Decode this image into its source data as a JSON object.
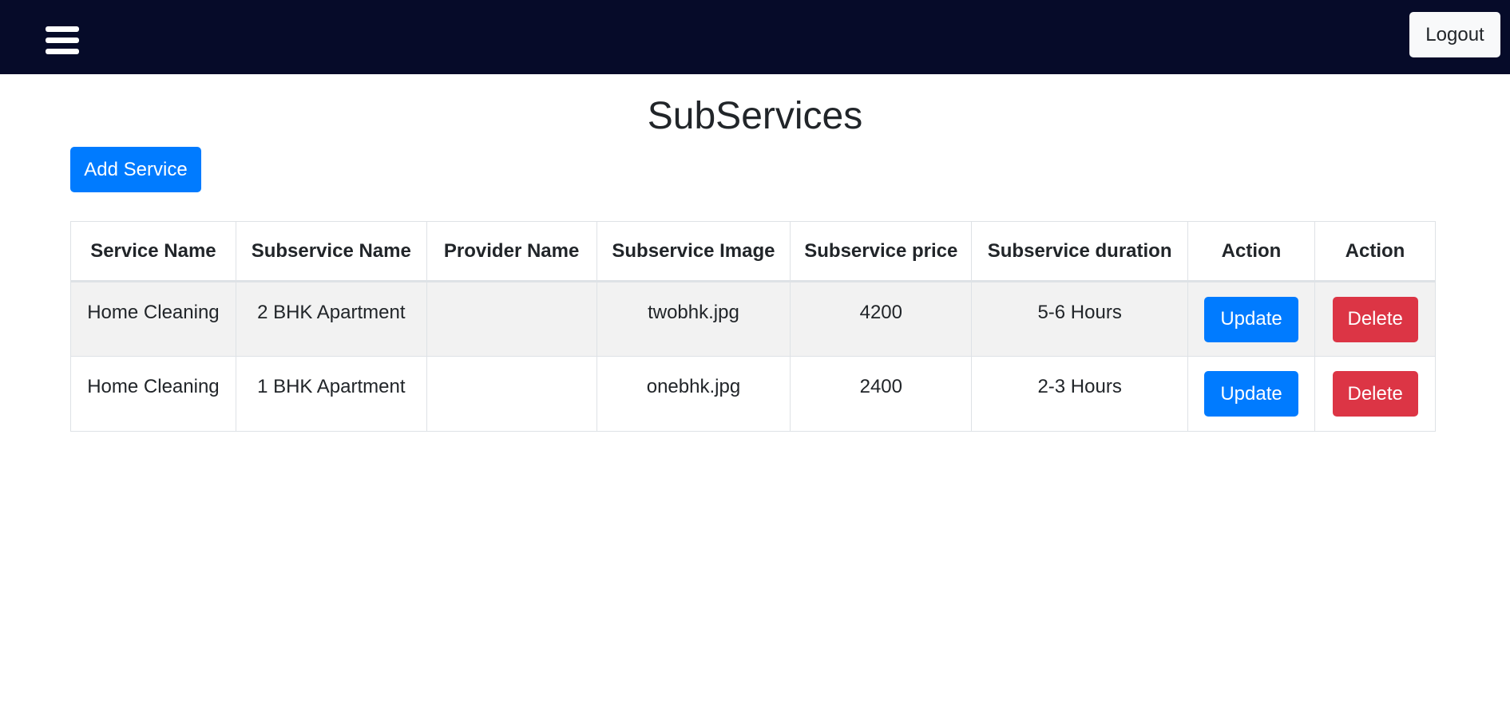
{
  "navbar": {
    "menu_icon": "hamburger-menu-icon",
    "logout_label": "Logout",
    "background": "#060b29"
  },
  "page": {
    "title": "SubServices",
    "add_button_label": "Add Service"
  },
  "table": {
    "headers": [
      "Service Name",
      "Subservice Name",
      "Provider Name",
      "Subservice Image",
      "Subservice price",
      "Subservice duration",
      "Action",
      "Action"
    ],
    "rows": [
      {
        "service_name": "Home Cleaning",
        "subservice_name": "2 BHK Apartment",
        "provider_name": "",
        "image": "twobhk.jpg",
        "price": "4200",
        "duration": "5-6 Hours",
        "update_label": "Update",
        "delete_label": "Delete"
      },
      {
        "service_name": "Home Cleaning",
        "subservice_name": "1 BHK Apartment",
        "provider_name": "",
        "image": "onebhk.jpg",
        "price": "2400",
        "duration": "2-3 Hours",
        "update_label": "Update",
        "delete_label": "Delete"
      }
    ]
  },
  "colors": {
    "primary": "#007bff",
    "danger": "#dc3545",
    "stripe": "#f2f2f2"
  }
}
